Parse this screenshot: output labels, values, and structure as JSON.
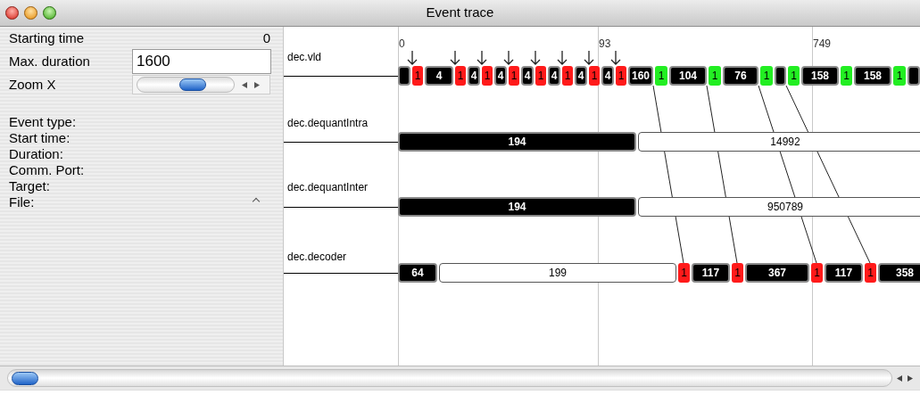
{
  "window": {
    "title": "Event trace"
  },
  "panel": {
    "fields": [
      {
        "kind": "value",
        "label": "Starting time",
        "value": "0"
      },
      {
        "kind": "input",
        "label": "Max. duration",
        "value": "1600"
      },
      {
        "kind": "slider",
        "label": "Zoom X",
        "level": 0.6
      }
    ],
    "details": [
      "Event type:",
      "Start time:",
      "Duration:",
      "Comm. Port:",
      "Target:",
      "File:"
    ]
  },
  "time_marks": [
    "0",
    "93",
    "749"
  ],
  "actors": [
    {
      "name": "dec.vld",
      "events": [
        {
          "kind": "dark",
          "arrow": false
        },
        {
          "kind": "red",
          "label": "1",
          "arrow": true
        },
        {
          "kind": "dark",
          "label": "4",
          "arrow": false
        },
        {
          "kind": "red",
          "label": "1",
          "arrow": true
        },
        {
          "kind": "dark",
          "label": "4",
          "arrow": false
        },
        {
          "kind": "red",
          "label": "1",
          "arrow": true
        },
        {
          "kind": "dark",
          "label": "4",
          "arrow": false
        },
        {
          "kind": "red",
          "label": "1",
          "arrow": true
        },
        {
          "kind": "dark",
          "label": "4",
          "arrow": false
        },
        {
          "kind": "red",
          "label": "1",
          "arrow": true
        },
        {
          "kind": "dark",
          "label": "4",
          "arrow": false
        },
        {
          "kind": "red",
          "label": "1",
          "arrow": true
        },
        {
          "kind": "dark",
          "label": "4",
          "arrow": false
        },
        {
          "kind": "red",
          "label": "1",
          "arrow": true
        },
        {
          "kind": "dark",
          "label": "4",
          "arrow": false
        },
        {
          "kind": "red",
          "label": "1",
          "arrow": true
        },
        {
          "kind": "dark",
          "label": "160",
          "arrow": false
        },
        {
          "kind": "green",
          "label": "1",
          "arrow": false
        },
        {
          "kind": "dark",
          "label": "104",
          "arrow": false
        },
        {
          "kind": "green",
          "label": "1",
          "arrow": false
        },
        {
          "kind": "dark",
          "label": "76",
          "arrow": false
        },
        {
          "kind": "green",
          "label": "1",
          "arrow": false
        },
        {
          "kind": "dark",
          "arrow": false
        },
        {
          "kind": "green",
          "label": "1",
          "arrow": false
        },
        {
          "kind": "dark",
          "label": "158",
          "arrow": false
        },
        {
          "kind": "green",
          "label": "1",
          "arrow": false
        },
        {
          "kind": "dark",
          "label": "158",
          "arrow": false
        },
        {
          "kind": "green",
          "label": "1",
          "arrow": false
        },
        {
          "kind": "dark",
          "arrow": false
        }
      ]
    },
    {
      "name": "dec.dequantIntra",
      "events": [
        {
          "kind": "dark",
          "label": "194"
        },
        {
          "kind": "light",
          "label": "14992"
        }
      ]
    },
    {
      "name": "dec.dequantInter",
      "events": [
        {
          "kind": "dark",
          "label": "194"
        },
        {
          "kind": "light",
          "label": "950789"
        }
      ]
    },
    {
      "name": "dec.decoder",
      "events": [
        {
          "kind": "dark",
          "label": "64"
        },
        {
          "kind": "light",
          "label": "199"
        },
        {
          "kind": "red",
          "label": "1"
        },
        {
          "kind": "dark",
          "label": "117"
        },
        {
          "kind": "red",
          "label": "1"
        },
        {
          "kind": "dark",
          "label": "367"
        },
        {
          "kind": "red",
          "label": "1"
        },
        {
          "kind": "dark",
          "label": "117"
        },
        {
          "kind": "red",
          "label": "1"
        },
        {
          "kind": "dark",
          "label": "358"
        }
      ]
    }
  ]
}
